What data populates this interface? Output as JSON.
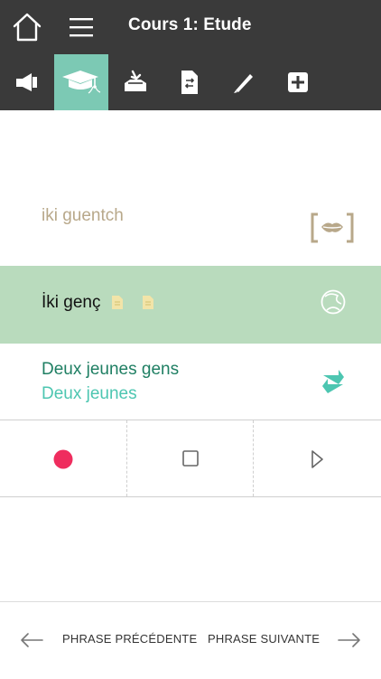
{
  "header": {
    "title": "Cours 1: Etude"
  },
  "toolbar": {
    "items": [
      {
        "name": "speaker-icon"
      },
      {
        "name": "graduation-cap-icon"
      },
      {
        "name": "inbox-download-icon"
      },
      {
        "name": "document-swap-icon"
      },
      {
        "name": "pencil-icon"
      },
      {
        "name": "plus-box-icon"
      }
    ],
    "active_index": 1
  },
  "phrase": {
    "phonetic": "iki guentch",
    "original": "İki genç",
    "translation_main": "Deux jeunes gens",
    "translation_sub": "Deux jeunes"
  },
  "controls": {
    "record_icon": "record-dot-icon",
    "stop_icon": "stop-square-icon",
    "play_icon": "play-triangle-icon"
  },
  "bottom_nav": {
    "prev_label": "PHRASE PRÉCÉDENTE",
    "next_label": "PHRASE SUIVANTE"
  },
  "colors": {
    "header_bg": "#3a3a3a",
    "active_tab": "#7cc9b4",
    "phonetic_text": "#b8a88a",
    "original_row_bg": "#b9dbbd",
    "translation_main": "#1f7f63",
    "translation_sub": "#4dc6b1",
    "record": "#ef2d5e"
  }
}
